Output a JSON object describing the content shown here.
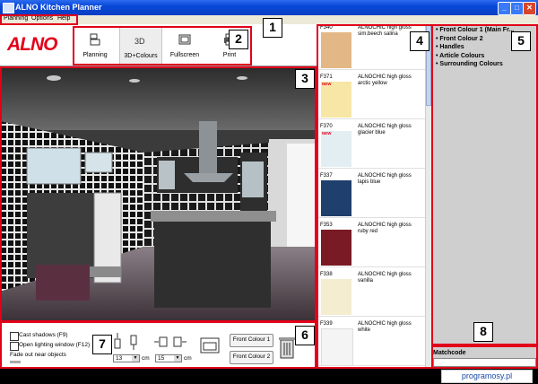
{
  "window": {
    "title": "ALNO Kitchen Planner",
    "minimize": "_",
    "maximize": "□",
    "close": "✕"
  },
  "menu": [
    "Planning",
    "Options",
    "Help"
  ],
  "logo": "ALNO",
  "toolbar": {
    "buttons": [
      {
        "label": "Planning",
        "icon": "planning-icon",
        "active": false
      },
      {
        "label": "3D+Colours",
        "icon": "3d-icon",
        "active": true
      },
      {
        "label": "Fullscreen",
        "icon": "fullscreen-icon",
        "active": false
      },
      {
        "label": "Print",
        "icon": "printer-icon",
        "active": false
      }
    ],
    "icon3d_text": "3D"
  },
  "options": {
    "cast_shadows": "Cast shadows (F9)",
    "open_lighting": "Open lighting window (F12)",
    "fade_out": "Fade out near objects"
  },
  "dimensions": {
    "height_value": "13",
    "width_value": "15",
    "unit": "cm"
  },
  "front_buttons": [
    "Front Colour 1",
    "Front Colour 2"
  ],
  "swatches": [
    {
      "code": "F340",
      "name": "ALNOCHIC high gloss sim.beech salina",
      "new": false,
      "color": "#e3b886"
    },
    {
      "code": "F371",
      "name": "ALNOCHIC high gloss arctic yellow",
      "new": true,
      "color": "#f6e7a6"
    },
    {
      "code": "F370",
      "name": "ALNOCHIC high gloss glacier blue",
      "new": true,
      "color": "#e2eef2"
    },
    {
      "code": "F337",
      "name": "ALNOCHIC high gloss lapis blue",
      "new": false,
      "color": "#1f3f6d"
    },
    {
      "code": "F353",
      "name": "ALNOCHIC high gloss ruby red",
      "new": false,
      "color": "#7a1a24"
    },
    {
      "code": "F338",
      "name": "ALNOCHIC high gloss vanilla",
      "new": false,
      "color": "#f4edcf"
    },
    {
      "code": "F339",
      "name": "ALNOCHIC high gloss white",
      "new": false,
      "color": "#f4f4f4"
    }
  ],
  "new_badge": "NEW",
  "categories": [
    "Front Colour 1 (Main Fr...",
    "Front Colour 2",
    "Handles",
    "Article Colours",
    "Surrounding Colours"
  ],
  "matchcode_label": "Matchcode",
  "watermark": "programosy.pl",
  "callouts": [
    "1",
    "2",
    "3",
    "4",
    "5",
    "6",
    "7",
    "8"
  ]
}
